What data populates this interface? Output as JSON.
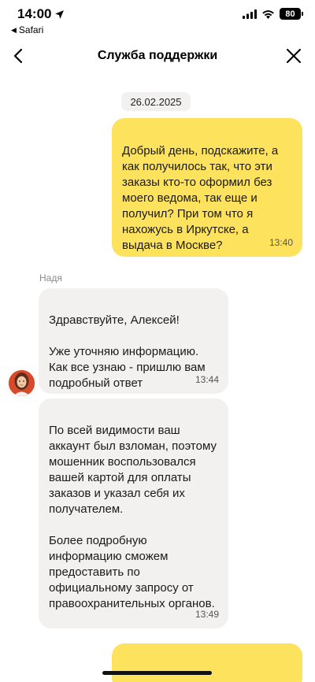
{
  "status_bar": {
    "time": "14:00",
    "back_app": "Safari",
    "battery": "80"
  },
  "header": {
    "title": "Служба поддержки"
  },
  "chat": {
    "date": "26.02.2025",
    "messages": [
      {
        "direction": "outgoing",
        "text": "Добрый день, подскажите, а как получилось так, что эти заказы кто-то оформил без моего ведома, так еще и получил? При том что я нахожусь в Иркутске, а выдача в Москве?",
        "time": "13:40"
      },
      {
        "direction": "incoming",
        "sender": "Надя",
        "text": "Здравствуйте, Алексей!\n\nУже уточняю информацию. Как все узнаю - пришлю вам подробный ответ",
        "time": "13:44"
      },
      {
        "direction": "incoming",
        "text": "По всей видимости ваш аккаунт был взломан, поэтому мошенник воспользовался вашей картой для оплаты заказов и указал себя их получателем.\n\nБолее подробную информацию сможем предоставить по официальному запросу от правоохранительных органов.",
        "time": "13:49"
      }
    ]
  },
  "colors": {
    "outgoing_bubble": "#fde25d",
    "incoming_bubble": "#f2f1ef",
    "avatar_bg": "#d94a2b"
  }
}
